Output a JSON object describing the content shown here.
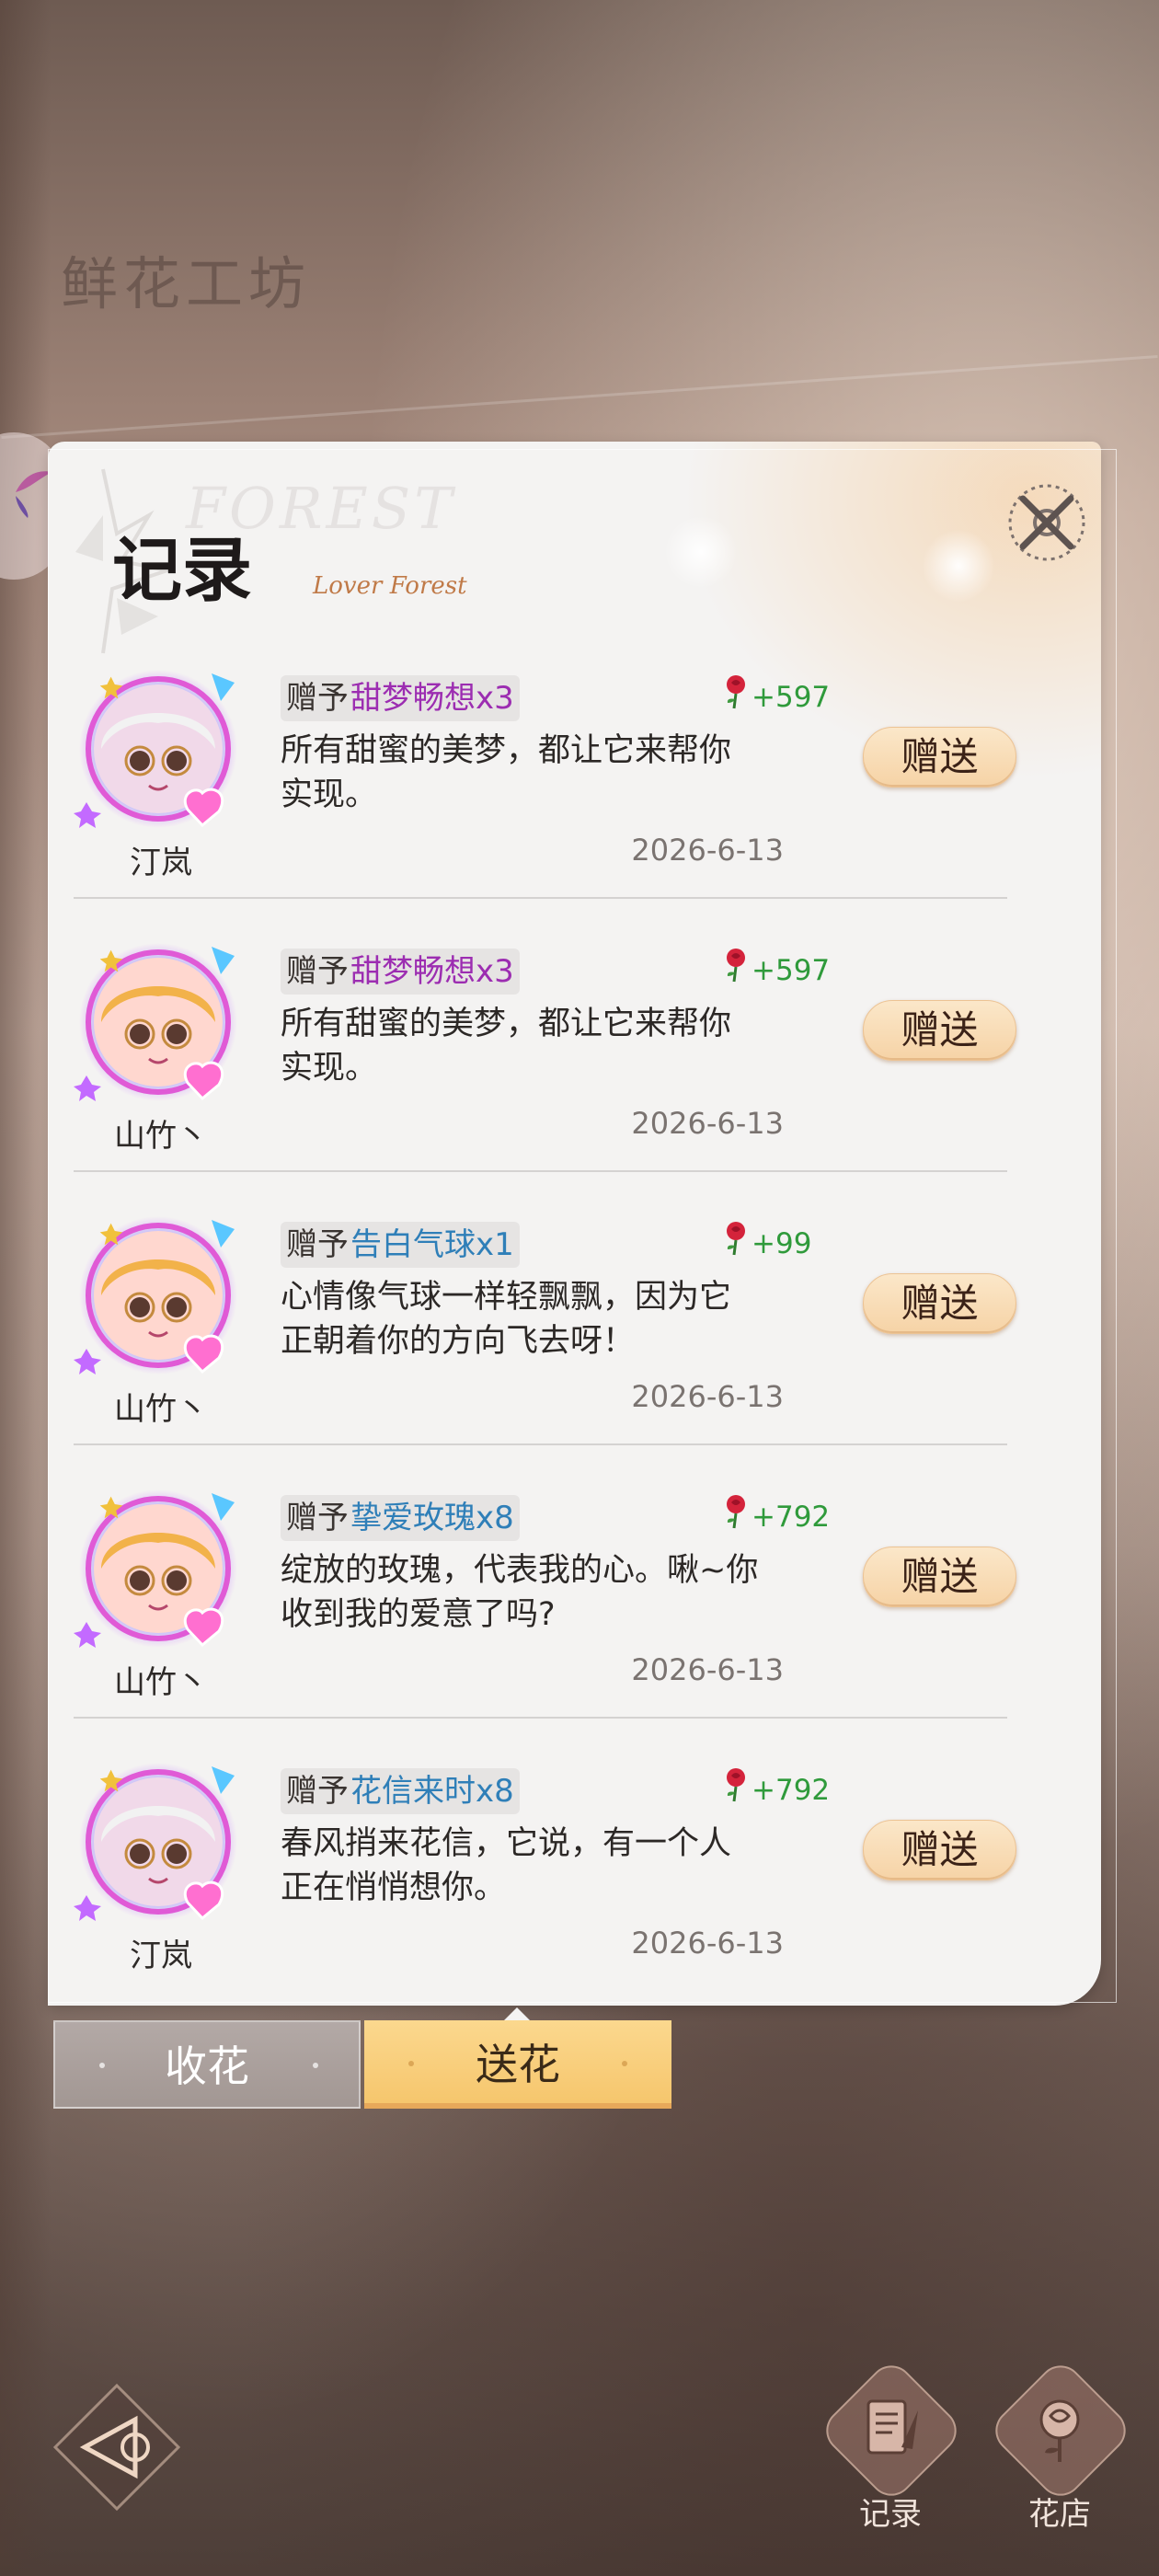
{
  "page": {
    "title": "鲜花工坊"
  },
  "panel": {
    "title": "记录",
    "subtitle": "Lover Forest",
    "watermark": "FOREST"
  },
  "records": [
    {
      "user": "汀岚",
      "avatar": "white-hair-glasses-boy-avatar",
      "gift_prefix": "赠予",
      "gift_name": "甜梦畅想x3",
      "gift_color": "#9c2db1",
      "points": "+597",
      "message": "所有甜蜜的美梦，都让它来帮你实现。",
      "date": "2026-6-13",
      "button": "赠送"
    },
    {
      "user": "山竹丶",
      "avatar": "blonde-girl-avatar",
      "gift_prefix": "赠予",
      "gift_name": "甜梦畅想x3",
      "gift_color": "#9c2db1",
      "points": "+597",
      "message": "所有甜蜜的美梦，都让它来帮你实现。",
      "date": "2026-6-13",
      "button": "赠送"
    },
    {
      "user": "山竹丶",
      "avatar": "blonde-girl-avatar",
      "gift_prefix": "赠予",
      "gift_name": "告白气球x1",
      "gift_color": "#2f7fb8",
      "points": "+99",
      "message": "心情像气球一样轻飘飘，因为它正朝着你的方向飞去呀！",
      "date": "2026-6-13",
      "button": "赠送"
    },
    {
      "user": "山竹丶",
      "avatar": "blonde-girl-avatar",
      "gift_prefix": "赠予",
      "gift_name": "挚爱玫瑰x8",
      "gift_color": "#2f7fb8",
      "points": "+792",
      "message": "绽放的玫瑰，代表我的心。啾~你收到我的爱意了吗?",
      "date": "2026-6-13",
      "button": "赠送"
    },
    {
      "user": "汀岚",
      "avatar": "white-hair-glasses-boy-avatar",
      "gift_prefix": "赠予",
      "gift_name": "花信来时x8",
      "gift_color": "#2f7fb8",
      "points": "+792",
      "message": "春风捎来花信，它说，有一个人正在悄悄想你。",
      "date": "2026-6-13",
      "button": "赠送"
    }
  ],
  "tabs": {
    "receive": "收花",
    "send": "送花",
    "active": "send"
  },
  "bottom_nav": {
    "records": "记录",
    "flower_shop": "花店"
  },
  "colors": {
    "points_green": "#2f9a3b",
    "purple_gift": "#9c2db1",
    "blue_gift": "#2f7fb8",
    "button_peach": "#f6d3a6",
    "tab_active": "#f6c66d"
  }
}
